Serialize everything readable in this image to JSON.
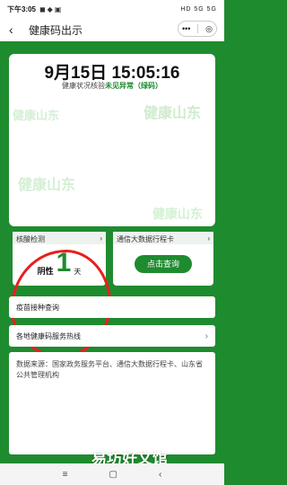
{
  "status_bar": {
    "time": "下午3:05",
    "right": "HD 5G 5G"
  },
  "nav": {
    "title": "健康码出示",
    "back_icon": "chevron-left-icon",
    "more_icon": "more-dots-icon",
    "close_icon": "close-circle-icon"
  },
  "code_card": {
    "datetime": "9月15日 15:05:16",
    "status_prefix": "健康状况核验",
    "status_value": "未见异常",
    "status_suffix": "（绿码）",
    "watermarks": [
      "健康山东",
      "健康山东",
      "健康山东",
      "健康山东"
    ]
  },
  "test_card": {
    "title": "核酸检测",
    "result": "阴性",
    "days": "1",
    "days_unit": "天",
    "chevron_icon": "chevron-right-icon"
  },
  "trip_card": {
    "title": "通信大数据行程卡",
    "button": "点击查询",
    "chevron_icon": "chevron-right-icon"
  },
  "list": {
    "vaccine": "疫苗接种查询",
    "hotline": "各地健康码服务热线"
  },
  "source_text": "数据来源：国家政务服务平台、通信大数据行程卡、山东省公共管理机构",
  "footer_watermark": "易坊好文馆",
  "bottom_nav": {
    "menu_icon": "menu-icon",
    "home_icon": "home-square-icon",
    "back_icon": "back-triangle-icon"
  },
  "colors": {
    "green": "#1f8b2f",
    "red_mark": "#e7201c"
  }
}
